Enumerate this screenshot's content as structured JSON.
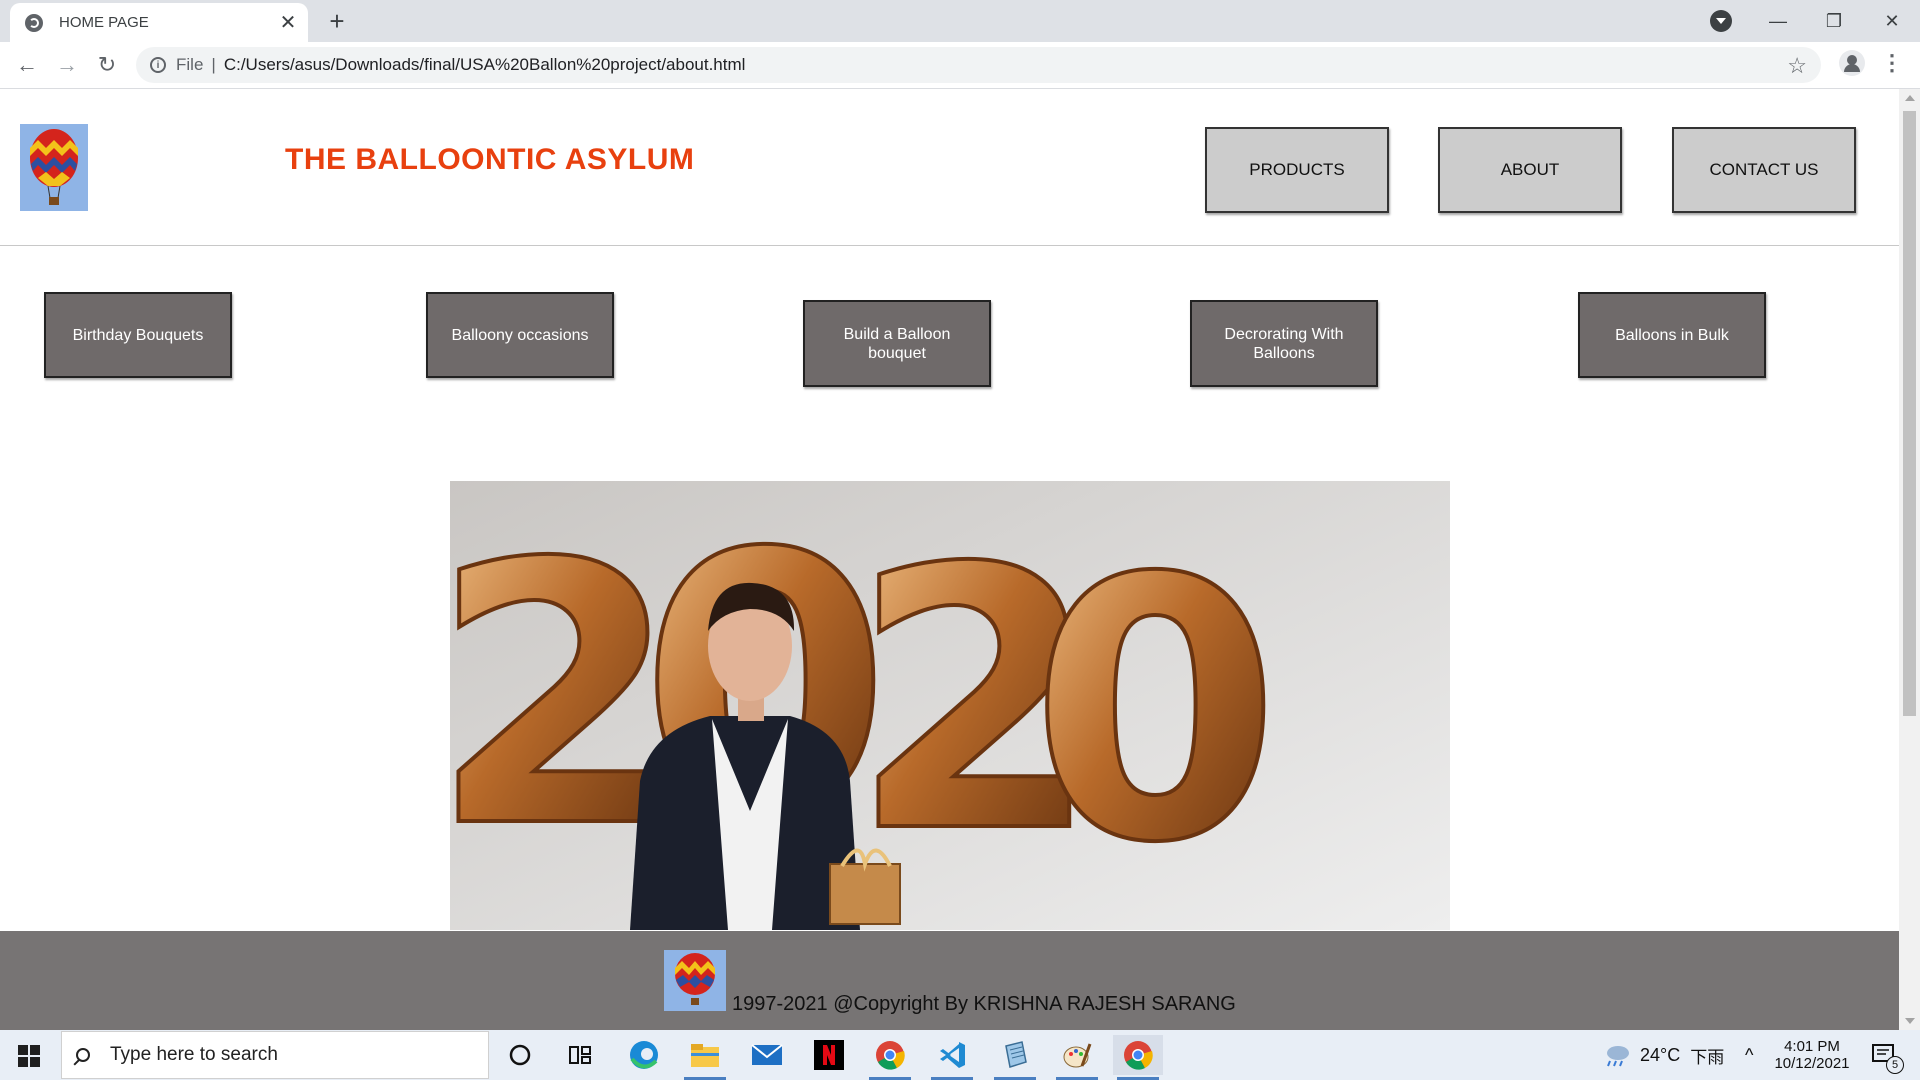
{
  "browser": {
    "tab_title": "HOME PAGE",
    "url_scheme": "File",
    "url": "C:/Users/asus/Downloads/final/USA%20Ballon%20project/about.html"
  },
  "site": {
    "title": "THE BALLOONTIC ASYLUM",
    "nav": [
      "PRODUCTS",
      "ABOUT",
      "CONTACT US"
    ],
    "categories": [
      "Birthday Bouquets",
      "Balloony occasions",
      "Build a Balloon bouquet",
      "Decrorating With Balloons",
      "Balloons in Bulk"
    ],
    "hero_image": "Man in suit holding a gift in front of gold 2020 foil balloons",
    "footer_text": "1997-2021 @Copyright By KRISHNA RAJESH SARANG",
    "colors": {
      "title": "#e8400f",
      "nav_button": "#cccccc",
      "category_button": "#6f6a6a",
      "footer": "#777474"
    }
  },
  "taskbar": {
    "search_placeholder": "Type here to search",
    "weather": "24°C",
    "weather_desc": "下雨",
    "time": "4:01 PM",
    "date": "10/12/2021",
    "notifications": "5"
  }
}
